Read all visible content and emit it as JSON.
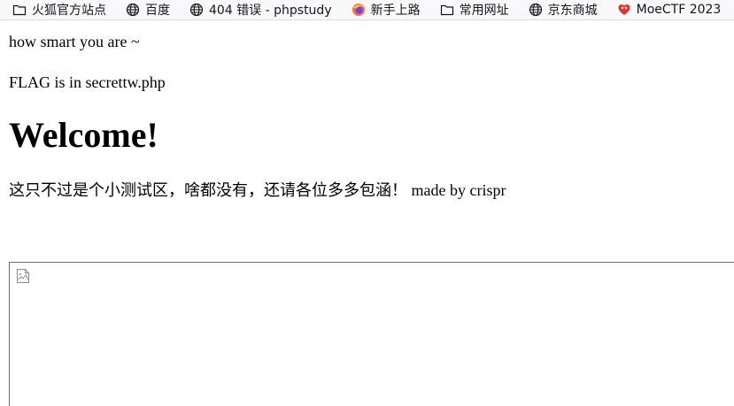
{
  "bookmarks": [
    {
      "label": "火狐官方站点",
      "icon": "folder-icon"
    },
    {
      "label": "百度",
      "icon": "globe-icon"
    },
    {
      "label": "404 错误 - phpstudy",
      "icon": "globe-icon"
    },
    {
      "label": "新手上路",
      "icon": "firefox-icon"
    },
    {
      "label": "常用网址",
      "icon": "folder-icon"
    },
    {
      "label": "京东商城",
      "icon": "globe-icon"
    },
    {
      "label": "MoeCTF 2023",
      "icon": "moectf-icon"
    }
  ],
  "page": {
    "line1": "how smart you are ~",
    "line2": "FLAG is in secrettw.php",
    "heading": "Welcome!",
    "line3": "这只不过是个小测试区，啥都没有，还请各位多多包涵！ made by crispr"
  },
  "frame": {
    "image_icon": "broken-image-icon"
  }
}
